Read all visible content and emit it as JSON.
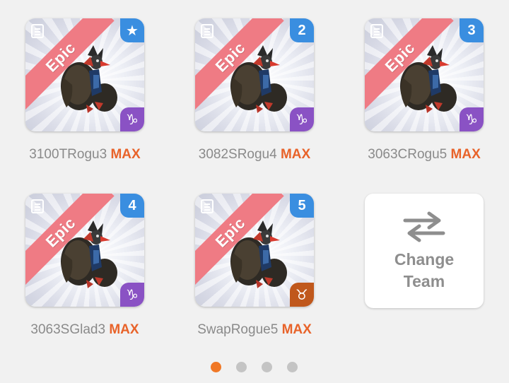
{
  "colors": {
    "epic_ribbon": "#ef7b84",
    "slot_badge": "#3a8ee0",
    "max": "#e8632a",
    "dot_active": "#f07826",
    "dot_inactive": "#c4c4c4"
  },
  "monsters": [
    {
      "name": "3100TRogu3",
      "level": "MAX",
      "rarity": "Epic",
      "slot_label": "★",
      "slot_icon": "star-icon",
      "zodiac": "♑",
      "zodiac_icon": "capricorn-icon",
      "zodiac_color": "#8a52c4"
    },
    {
      "name": "3082SRogu4",
      "level": "MAX",
      "rarity": "Epic",
      "slot_label": "2",
      "slot_icon": "slot-number",
      "zodiac": "♑",
      "zodiac_icon": "capricorn-icon",
      "zodiac_color": "#8a52c4"
    },
    {
      "name": "3063CRogu5",
      "level": "MAX",
      "rarity": "Epic",
      "slot_label": "3",
      "slot_icon": "slot-number",
      "zodiac": "♑",
      "zodiac_icon": "capricorn-icon",
      "zodiac_color": "#8a52c4"
    },
    {
      "name": "3063SGlad3",
      "level": "MAX",
      "rarity": "Epic",
      "slot_label": "4",
      "slot_icon": "slot-number",
      "zodiac": "♑",
      "zodiac_icon": "capricorn-icon",
      "zodiac_color": "#8a52c4"
    },
    {
      "name": "SwapRogue5",
      "level": "MAX",
      "rarity": "Epic",
      "slot_label": "5",
      "slot_icon": "slot-number",
      "zodiac": "♉",
      "zodiac_icon": "taurus-icon",
      "zodiac_color": "#c0581c"
    }
  ],
  "change_team": {
    "label_line1": "Change",
    "label_line2": "Team",
    "icon": "swap-arrows-icon"
  },
  "pagination": {
    "total": 4,
    "active": 1
  }
}
